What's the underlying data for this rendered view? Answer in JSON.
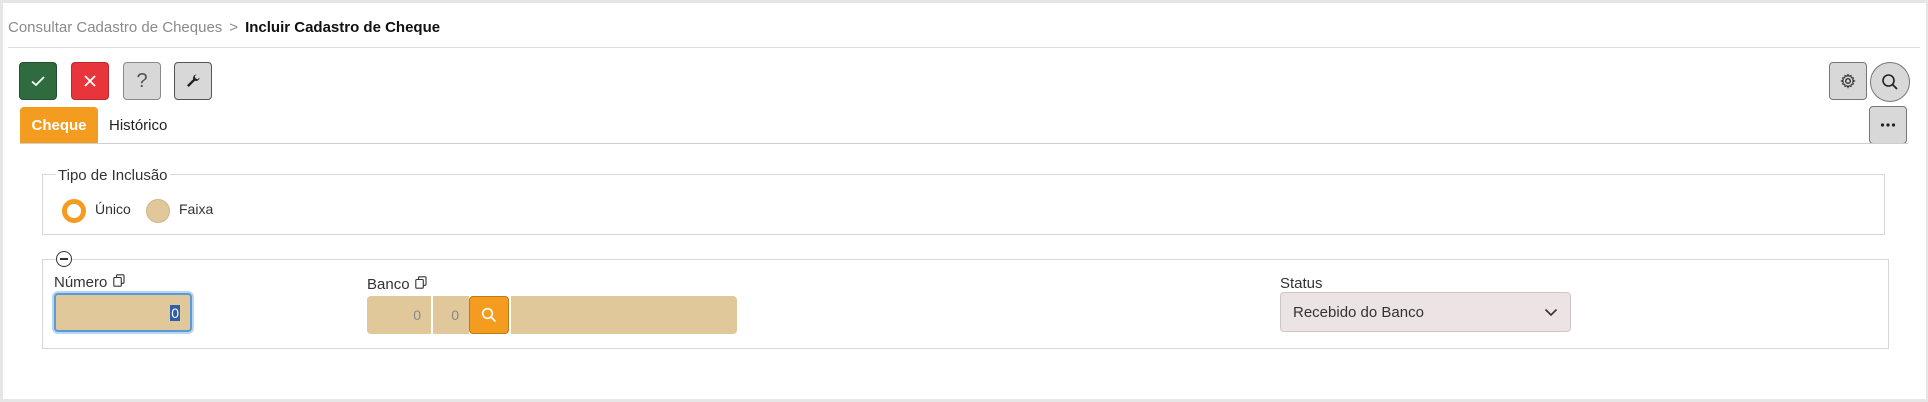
{
  "breadcrumb": {
    "parent": "Consultar Cadastro de Cheques",
    "separator": ">",
    "current": "Incluir Cadastro de Cheque"
  },
  "toolbar": {
    "confirm_icon": "check-icon",
    "cancel_icon": "close-icon",
    "help_label": "?",
    "tool_icon": "wrench-icon",
    "settings_icon": "gear-icon",
    "search_icon": "search-icon",
    "more_icon": "more-horizontal-icon"
  },
  "tabs": [
    {
      "label": "Cheque",
      "active": true
    },
    {
      "label": "Histórico",
      "active": false
    }
  ],
  "tipo_inclusao": {
    "legend": "Tipo de Inclusão",
    "options": [
      {
        "label": "Único",
        "selected": true
      },
      {
        "label": "Faixa",
        "selected": false
      }
    ]
  },
  "form": {
    "numero": {
      "label": "Número",
      "value": "0"
    },
    "banco": {
      "label": "Banco",
      "code1": "0",
      "code2": "0",
      "name": ""
    },
    "status": {
      "label": "Status",
      "value": "Recebido do Banco"
    }
  },
  "colors": {
    "accent": "#f39c1f",
    "confirm": "#2e6b3f",
    "cancel": "#e8343b",
    "field_bg": "#e0c89a",
    "select_bg": "#ece4e4"
  }
}
